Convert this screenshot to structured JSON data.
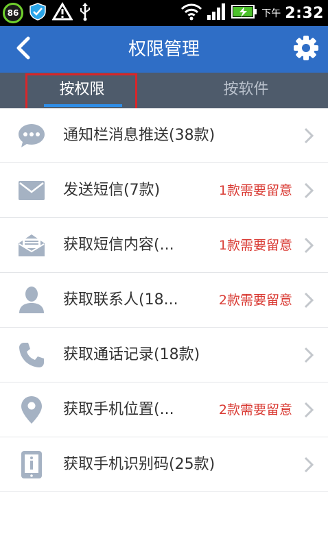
{
  "status_bar": {
    "battery_saver_percent": "86",
    "ampm": "下午",
    "time": "2:32"
  },
  "header": {
    "title": "权限管理"
  },
  "tabs": [
    {
      "label": "按权限",
      "selected": true
    },
    {
      "label": "按软件",
      "selected": false
    }
  ],
  "colors": {
    "title_bar": "#2f6ec6",
    "tab_bar": "#4e5b6b",
    "warning": "#d93a33",
    "icon": "#a5b2c3",
    "highlight_box": "#d9262a"
  },
  "permissions": [
    {
      "icon": "chat-bubble-icon",
      "label": "通知栏消息推送(38款)",
      "warning": ""
    },
    {
      "icon": "envelope-icon",
      "label": "发送短信(7款)",
      "warning": "1款需要留意"
    },
    {
      "icon": "envelope-open-icon",
      "label": "获取短信内容(...",
      "warning": "1款需要留意"
    },
    {
      "icon": "person-icon",
      "label": "获取联系人(18...",
      "warning": "2款需要留意"
    },
    {
      "icon": "phone-icon",
      "label": "获取通话记录(18款)",
      "warning": ""
    },
    {
      "icon": "location-pin-icon",
      "label": "获取手机位置(...",
      "warning": "2款需要留意"
    },
    {
      "icon": "phone-id-icon",
      "label": "获取手机识别码(25款)",
      "warning": ""
    }
  ]
}
